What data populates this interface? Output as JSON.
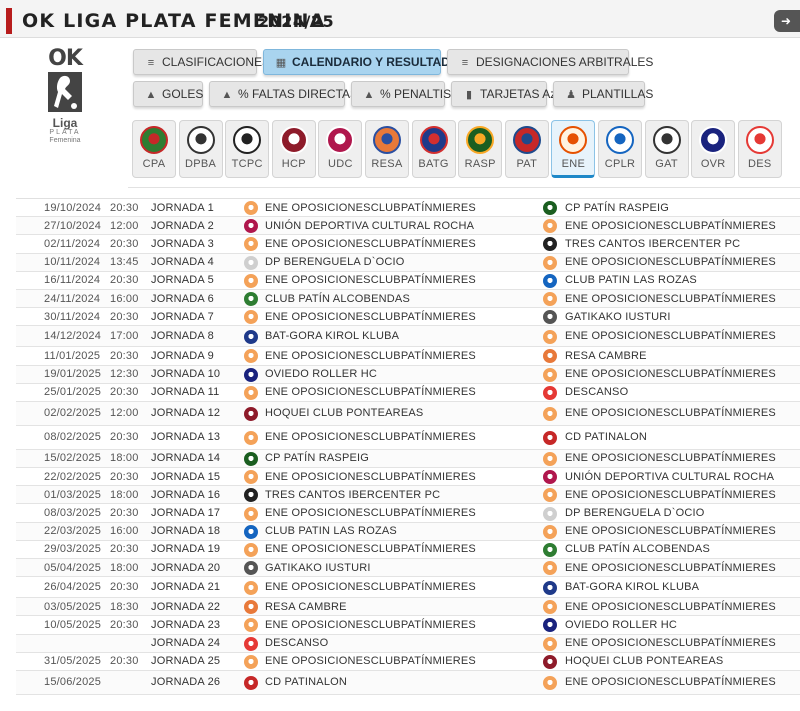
{
  "header": {
    "title": "OK LIGA PLATA FEMENINA",
    "season": "2024/25",
    "back_icon": "back-arrow-icon"
  },
  "logo": {
    "ok": "OK",
    "liga": "Liga",
    "plata": "PLATA",
    "femenina": "Femenina"
  },
  "nav": [
    {
      "label": "CLASIFICACIONES",
      "icon": "list-icon",
      "glyph": "≡",
      "active": false
    },
    {
      "label": "CALENDARIO Y RESULTADOS",
      "icon": "calendar-icon",
      "glyph": "▦",
      "active": true
    },
    {
      "label": "DESIGNACIONES ARBITRALES",
      "icon": "list-icon",
      "glyph": "≡",
      "active": false
    },
    {
      "label": "GOLES",
      "icon": "chart-icon",
      "glyph": "▲",
      "active": false
    },
    {
      "label": "% FALTAS DIRECTAS",
      "icon": "chart-icon",
      "glyph": "▲",
      "active": false
    },
    {
      "label": "% PENALTIS",
      "icon": "chart-icon",
      "glyph": "▲",
      "active": false
    },
    {
      "label": "TARJETAS Az",
      "icon": "card-icon",
      "glyph": "▮",
      "active": false
    },
    {
      "label": "PLANTILLAS",
      "icon": "person-icon",
      "glyph": "♟",
      "active": false
    }
  ],
  "teams": [
    {
      "abbr": "CPA",
      "color": "#2e7d32",
      "accent": "#c62828",
      "active": false
    },
    {
      "abbr": "DPBA",
      "color": "#ffffff",
      "accent": "#333333",
      "active": false
    },
    {
      "abbr": "TCPC",
      "color": "#ffffff",
      "accent": "#222222",
      "active": false
    },
    {
      "abbr": "HCP",
      "color": "#8e1b2a",
      "accent": "#ffffff",
      "active": false
    },
    {
      "abbr": "UDC",
      "color": "#b0174d",
      "accent": "#ffffff",
      "active": false
    },
    {
      "abbr": "RESA",
      "color": "#e8793a",
      "accent": "#2a4fa1",
      "active": false
    },
    {
      "abbr": "BATG",
      "color": "#1f3a8a",
      "accent": "#d32f2f",
      "active": false
    },
    {
      "abbr": "RASP",
      "color": "#1b5e20",
      "accent": "#f9a825",
      "active": false
    },
    {
      "abbr": "PAT",
      "color": "#c62828",
      "accent": "#1e4a8c",
      "active": false
    },
    {
      "abbr": "ENE",
      "color": "#fff3e0",
      "accent": "#e65100",
      "active": true
    },
    {
      "abbr": "CPLR",
      "color": "#ffffff",
      "accent": "#1565c0",
      "active": false
    },
    {
      "abbr": "GAT",
      "color": "#ffffff",
      "accent": "#333333",
      "active": false
    },
    {
      "abbr": "OVR",
      "color": "#1a237e",
      "accent": "#ffffff",
      "active": false
    },
    {
      "abbr": "DES",
      "color": "#ffffff",
      "accent": "#e53935",
      "active": false
    }
  ],
  "team_colors": {
    "ENE": "#f4a259",
    "CPA": "#2e7d32",
    "DPBA": "#cfcfcf",
    "TCPC": "#222222",
    "HCP": "#8e1b2a",
    "UDC": "#b0174d",
    "RESA": "#e8793a",
    "BATG": "#1f3a8a",
    "RASP": "#1b5e20",
    "PAT": "#c62828",
    "CPLR": "#1565c0",
    "GAT": "#555555",
    "OVR": "#1a237e",
    "DES": "#e53935"
  },
  "matches": [
    {
      "date": "19/10/2024",
      "time": "20:30",
      "jornada": "JORNADA 1",
      "home": "ENE OPOSICIONESCLUBPATÍNMIERES",
      "home_code": "ENE",
      "away": "CP PATÍN RASPEIG",
      "away_code": "RASP"
    },
    {
      "date": "27/10/2024",
      "time": "12:00",
      "jornada": "JORNADA 2",
      "home": "UNIÓN DEPORTIVA CULTURAL ROCHA",
      "home_code": "UDC",
      "away": "ENE OPOSICIONESCLUBPATÍNMIERES",
      "away_code": "ENE"
    },
    {
      "date": "02/11/2024",
      "time": "20:30",
      "jornada": "JORNADA 3",
      "home": "ENE OPOSICIONESCLUBPATÍNMIERES",
      "home_code": "ENE",
      "away": "TRES CANTOS IBERCENTER PC",
      "away_code": "TCPC"
    },
    {
      "date": "10/11/2024",
      "time": "13:45",
      "jornada": "JORNADA 4",
      "home": "DP BERENGUELA D`OCIO",
      "home_code": "DPBA",
      "away": "ENE OPOSICIONESCLUBPATÍNMIERES",
      "away_code": "ENE"
    },
    {
      "date": "16/11/2024",
      "time": "20:30",
      "jornada": "JORNADA 5",
      "home": "ENE OPOSICIONESCLUBPATÍNMIERES",
      "home_code": "ENE",
      "away": "CLUB PATIN LAS ROZAS",
      "away_code": "CPLR"
    },
    {
      "date": "24/11/2024",
      "time": "16:00",
      "jornada": "JORNADA 6",
      "home": "CLUB PATÍN ALCOBENDAS",
      "home_code": "CPA",
      "away": "ENE OPOSICIONESCLUBPATÍNMIERES",
      "away_code": "ENE"
    },
    {
      "date": "30/11/2024",
      "time": "20:30",
      "jornada": "JORNADA 7",
      "home": "ENE OPOSICIONESCLUBPATÍNMIERES",
      "home_code": "ENE",
      "away": "GATIKAKO IUSTURI",
      "away_code": "GAT"
    },
    {
      "date": "14/12/2024",
      "time": "17:00",
      "jornada": "JORNADA 8",
      "home": "BAT-GORA KIROL KLUBA",
      "home_code": "BATG",
      "away": "ENE OPOSICIONESCLUBPATÍNMIERES",
      "away_code": "ENE"
    },
    {
      "date": "11/01/2025",
      "time": "20:30",
      "jornada": "JORNADA 9",
      "home": "ENE OPOSICIONESCLUBPATÍNMIERES",
      "home_code": "ENE",
      "away": "RESA CAMBRE",
      "away_code": "RESA"
    },
    {
      "date": "19/01/2025",
      "time": "12:30",
      "jornada": "JORNADA 10",
      "home": "OVIEDO ROLLER HC",
      "home_code": "OVR",
      "away": "ENE OPOSICIONESCLUBPATÍNMIERES",
      "away_code": "ENE"
    },
    {
      "date": "25/01/2025",
      "time": "20:30",
      "jornada": "JORNADA 11",
      "home": "ENE OPOSICIONESCLUBPATÍNMIERES",
      "home_code": "ENE",
      "away": "DESCANSO",
      "away_code": "DES"
    },
    {
      "date": "02/02/2025",
      "time": "12:00",
      "jornada": "JORNADA 12",
      "home": "HOQUEI CLUB PONTEAREAS",
      "home_code": "HCP",
      "away": "ENE OPOSICIONESCLUBPATÍNMIERES",
      "away_code": "ENE"
    },
    {
      "date": "08/02/2025",
      "time": "20:30",
      "jornada": "JORNADA 13",
      "home": "ENE OPOSICIONESCLUBPATÍNMIERES",
      "home_code": "ENE",
      "away": "CD PATINALON",
      "away_code": "PAT"
    },
    {
      "date": "15/02/2025",
      "time": "18:00",
      "jornada": "JORNADA 14",
      "home": "CP PATÍN RASPEIG",
      "home_code": "RASP",
      "away": "ENE OPOSICIONESCLUBPATÍNMIERES",
      "away_code": "ENE"
    },
    {
      "date": "22/02/2025",
      "time": "20:30",
      "jornada": "JORNADA 15",
      "home": "ENE OPOSICIONESCLUBPATÍNMIERES",
      "home_code": "ENE",
      "away": "UNIÓN DEPORTIVA CULTURAL ROCHA",
      "away_code": "UDC"
    },
    {
      "date": "01/03/2025",
      "time": "18:00",
      "jornada": "JORNADA 16",
      "home": "TRES CANTOS IBERCENTER PC",
      "home_code": "TCPC",
      "away": "ENE OPOSICIONESCLUBPATÍNMIERES",
      "away_code": "ENE"
    },
    {
      "date": "08/03/2025",
      "time": "20:30",
      "jornada": "JORNADA 17",
      "home": "ENE OPOSICIONESCLUBPATÍNMIERES",
      "home_code": "ENE",
      "away": "DP BERENGUELA D`OCIO",
      "away_code": "DPBA"
    },
    {
      "date": "22/03/2025",
      "time": "16:00",
      "jornada": "JORNADA 18",
      "home": "CLUB PATIN LAS ROZAS",
      "home_code": "CPLR",
      "away": "ENE OPOSICIONESCLUBPATÍNMIERES",
      "away_code": "ENE"
    },
    {
      "date": "29/03/2025",
      "time": "20:30",
      "jornada": "JORNADA 19",
      "home": "ENE OPOSICIONESCLUBPATÍNMIERES",
      "home_code": "ENE",
      "away": "CLUB PATÍN ALCOBENDAS",
      "away_code": "CPA"
    },
    {
      "date": "05/04/2025",
      "time": "18:00",
      "jornada": "JORNADA 20",
      "home": "GATIKAKO IUSTURI",
      "home_code": "GAT",
      "away": "ENE OPOSICIONESCLUBPATÍNMIERES",
      "away_code": "ENE"
    },
    {
      "date": "26/04/2025",
      "time": "20:30",
      "jornada": "JORNADA 21",
      "home": "ENE OPOSICIONESCLUBPATÍNMIERES",
      "home_code": "ENE",
      "away": "BAT-GORA KIROL KLUBA",
      "away_code": "BATG"
    },
    {
      "date": "03/05/2025",
      "time": "18:30",
      "jornada": "JORNADA 22",
      "home": "RESA CAMBRE",
      "home_code": "RESA",
      "away": "ENE OPOSICIONESCLUBPATÍNMIERES",
      "away_code": "ENE"
    },
    {
      "date": "10/05/2025",
      "time": "20:30",
      "jornada": "JORNADA 23",
      "home": "ENE OPOSICIONESCLUBPATÍNMIERES",
      "home_code": "ENE",
      "away": "OVIEDO ROLLER HC",
      "away_code": "OVR"
    },
    {
      "date": "",
      "time": "",
      "jornada": "JORNADA 24",
      "home": "DESCANSO",
      "home_code": "DES",
      "away": "ENE OPOSICIONESCLUBPATÍNMIERES",
      "away_code": "ENE"
    },
    {
      "date": "31/05/2025",
      "time": "20:30",
      "jornada": "JORNADA 25",
      "home": "ENE OPOSICIONESCLUBPATÍNMIERES",
      "home_code": "ENE",
      "away": "HOQUEI CLUB PONTEAREAS",
      "away_code": "HCP"
    },
    {
      "date": "15/06/2025",
      "time": "",
      "jornada": "JORNADA 26",
      "home": "CD PATINALON",
      "home_code": "PAT",
      "away": "ENE OPOSICIONESCLUBPATÍNMIERES",
      "away_code": "ENE"
    }
  ]
}
